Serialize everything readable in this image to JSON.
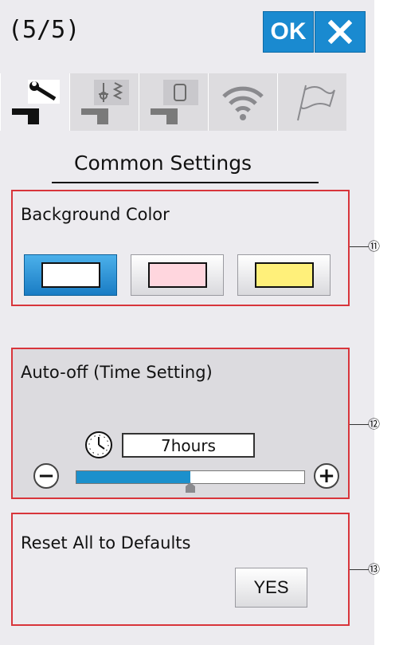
{
  "header": {
    "page_indicator": "(5/5)",
    "ok_label": "OK",
    "close_icon": "close-icon"
  },
  "tabs": [
    {
      "icon": "wrench-machine-icon",
      "active": true
    },
    {
      "icon": "sewing-stitch-icon",
      "active": false
    },
    {
      "icon": "embroidery-hoop-icon",
      "active": false
    },
    {
      "icon": "wifi-icon",
      "active": false
    },
    {
      "icon": "flag-icon",
      "active": false
    }
  ],
  "section_title": "Common Settings",
  "background_color": {
    "label": "Background Color",
    "options": [
      {
        "swatch": "#ffffff",
        "selected": true
      },
      {
        "swatch": "#ffd6de",
        "selected": false
      },
      {
        "swatch": "#fff07a",
        "selected": false
      }
    ]
  },
  "auto_off": {
    "label": "Auto-off (Time Setting)",
    "value": "7hours",
    "minus_label": "−",
    "plus_label": "+",
    "level": 0.5
  },
  "reset": {
    "label": "Reset All to Defaults",
    "yes_label": "YES"
  },
  "callouts": [
    "⑪",
    "⑫",
    "⑬"
  ],
  "colors": {
    "accent": "#1a8ad0",
    "frame": "#d8353b",
    "slider": "#1b90cc"
  }
}
